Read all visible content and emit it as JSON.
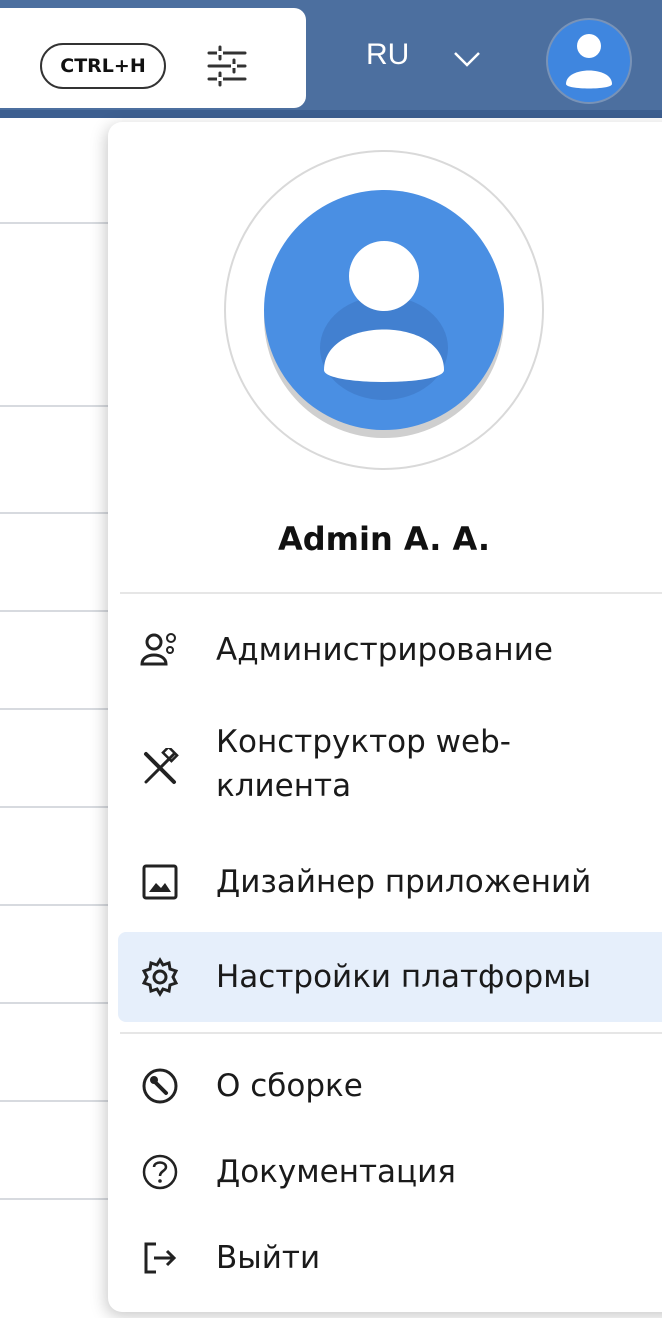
{
  "header": {
    "hotkey": "CTRL+H",
    "language": "RU",
    "filter_icon": "sliders-icon",
    "chevron_icon": "chevron-down-icon",
    "avatar_icon": "user-avatar-icon",
    "colors": {
      "bar": "#4c6f9f",
      "avatar": "#3f86df"
    }
  },
  "profile": {
    "name": "Admin A. A.",
    "avatar_icon": "user-avatar-icon"
  },
  "menu": {
    "items": [
      {
        "label": "Администрирование",
        "icon": "admin-users-icon"
      },
      {
        "label": "Конструктор web-клиента",
        "icon": "tools-icon"
      },
      {
        "label": "Дизайнер приложений",
        "icon": "image-icon"
      },
      {
        "label": "Настройки платформы",
        "icon": "settings-gear-icon",
        "active": true
      },
      {
        "label": "О сборке",
        "icon": "wrench-icon"
      },
      {
        "label": "Документация",
        "icon": "help-icon"
      },
      {
        "label": "Выйти",
        "icon": "logout-icon"
      }
    ]
  }
}
